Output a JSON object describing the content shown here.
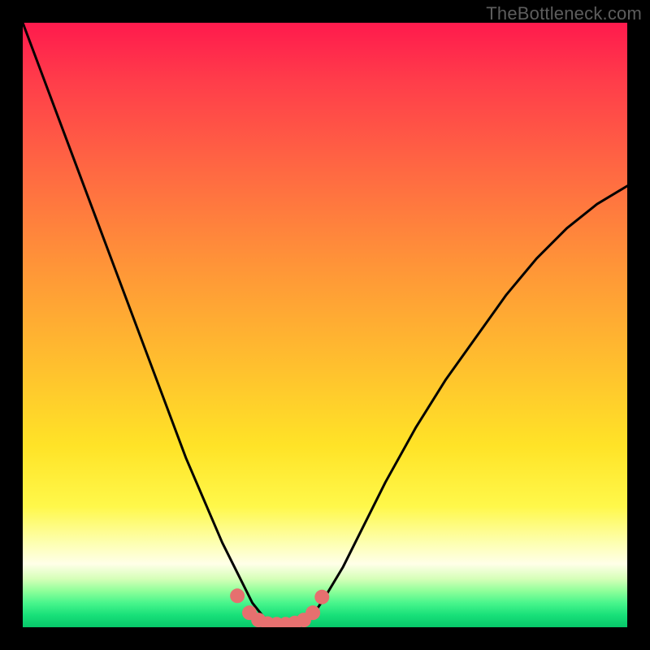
{
  "watermark": "TheBottleneck.com",
  "colors": {
    "curve": "#000000",
    "marker": "#e6706f",
    "bg_frame": "#000000"
  },
  "chart_data": {
    "type": "line",
    "title": "",
    "xlabel": "",
    "ylabel": "",
    "xlim": [
      0,
      100
    ],
    "ylim": [
      0,
      100
    ],
    "grid": false,
    "legend": false,
    "series": [
      {
        "name": "bottleneck-curve",
        "x": [
          0,
          3,
          6,
          9,
          12,
          15,
          18,
          21,
          24,
          27,
          30,
          33,
          36,
          38,
          40,
          42,
          44,
          46,
          48,
          50,
          53,
          56,
          60,
          65,
          70,
          75,
          80,
          85,
          90,
          95,
          100
        ],
        "y": [
          100,
          92,
          84,
          76,
          68,
          60,
          52,
          44,
          36,
          28,
          21,
          14,
          8,
          4,
          1.5,
          0.5,
          0.5,
          0.8,
          2,
          5,
          10,
          16,
          24,
          33,
          41,
          48,
          55,
          61,
          66,
          70,
          73
        ]
      }
    ],
    "markers": {
      "name": "emphasis-dots",
      "x": [
        35.5,
        37.5,
        39,
        40.5,
        42,
        43.5,
        45,
        46.5,
        48,
        49.5
      ],
      "y": [
        5.2,
        2.4,
        1.2,
        0.6,
        0.5,
        0.5,
        0.7,
        1.2,
        2.4,
        5.0
      ]
    }
  }
}
